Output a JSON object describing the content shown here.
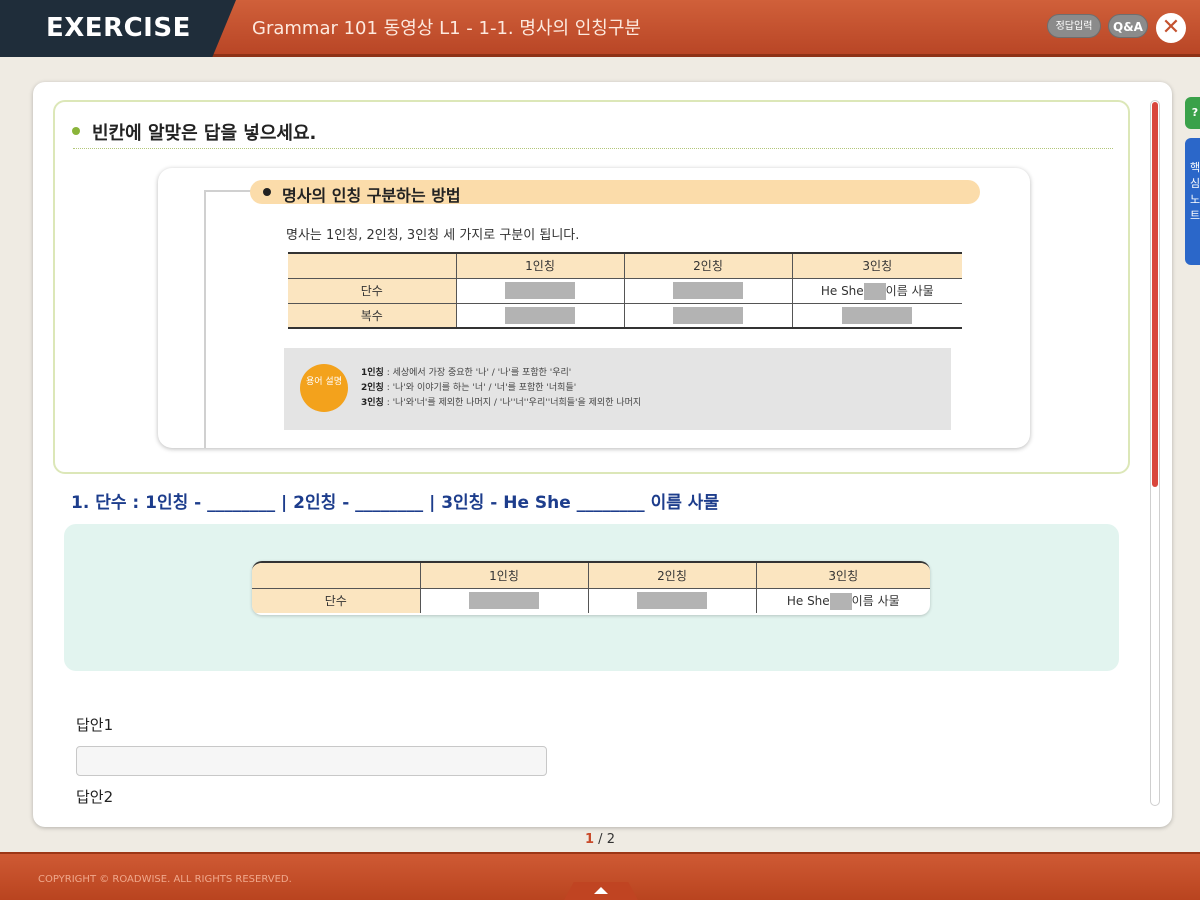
{
  "header": {
    "brand": "EXERCISE",
    "title": "Grammar 101 동영상 L1 - 1-1. 명사의 인칭구분",
    "answer_button": "정답입력",
    "qa_button": "Q&A",
    "close_icon": "close-icon"
  },
  "side_tabs": {
    "green_label": "?",
    "blue_label": "핵심노트"
  },
  "content": {
    "instruction": "빈칸에 알맞은 답을 넣으세요.",
    "section_title": "명사의 인칭 구분하는 방법",
    "section_desc": "명사는 1인칭, 2인칭, 3인칭 세 가지로 구분이 됩니다.",
    "table1": {
      "headers": [
        "",
        "1인칭",
        "2인칭",
        "3인칭"
      ],
      "row1_label": "단수",
      "row1_third_prefix": "He She",
      "row1_third_suffix": "이름 사물",
      "row2_label": "복수"
    },
    "note": {
      "badge": "용어 설명",
      "lines": [
        {
          "label": "1인칭",
          "text": " : 세상에서 가장 중요한 '나' / '나'를 포함한 '우리'"
        },
        {
          "label": "2인칭",
          "text": " : '나'와 이야기를 하는 '너' / '너'를 포함한 '너희들'"
        },
        {
          "label": "3인칭",
          "text": " : '나'와'너'를 제외한 나머지 / '나''너''우리''너희들'을 제외한 나머지"
        }
      ]
    },
    "question": "1. 단수 : 1인칭 - ________ | 2인칭 - ________ | 3인칭 - He She ________ 이름 사물",
    "table2": {
      "headers": [
        "",
        "1인칭",
        "2인칭",
        "3인칭"
      ],
      "row1_label": "단수",
      "row1_third_prefix": "He She",
      "row1_third_suffix": "이름 사물"
    },
    "answer1_label": "답안1",
    "answer1_value": "",
    "answer2_label": "답안2"
  },
  "pager": {
    "current": "1",
    "separator": " / ",
    "total": "2"
  },
  "footer": {
    "copyright": "COPYRIGHT © ROADWISE. ALL RIGHTS RESERVED."
  },
  "colors": {
    "accent": "#c4522f",
    "question_text": "#1d3d8c",
    "scroll_thumb": "#d9463c"
  }
}
